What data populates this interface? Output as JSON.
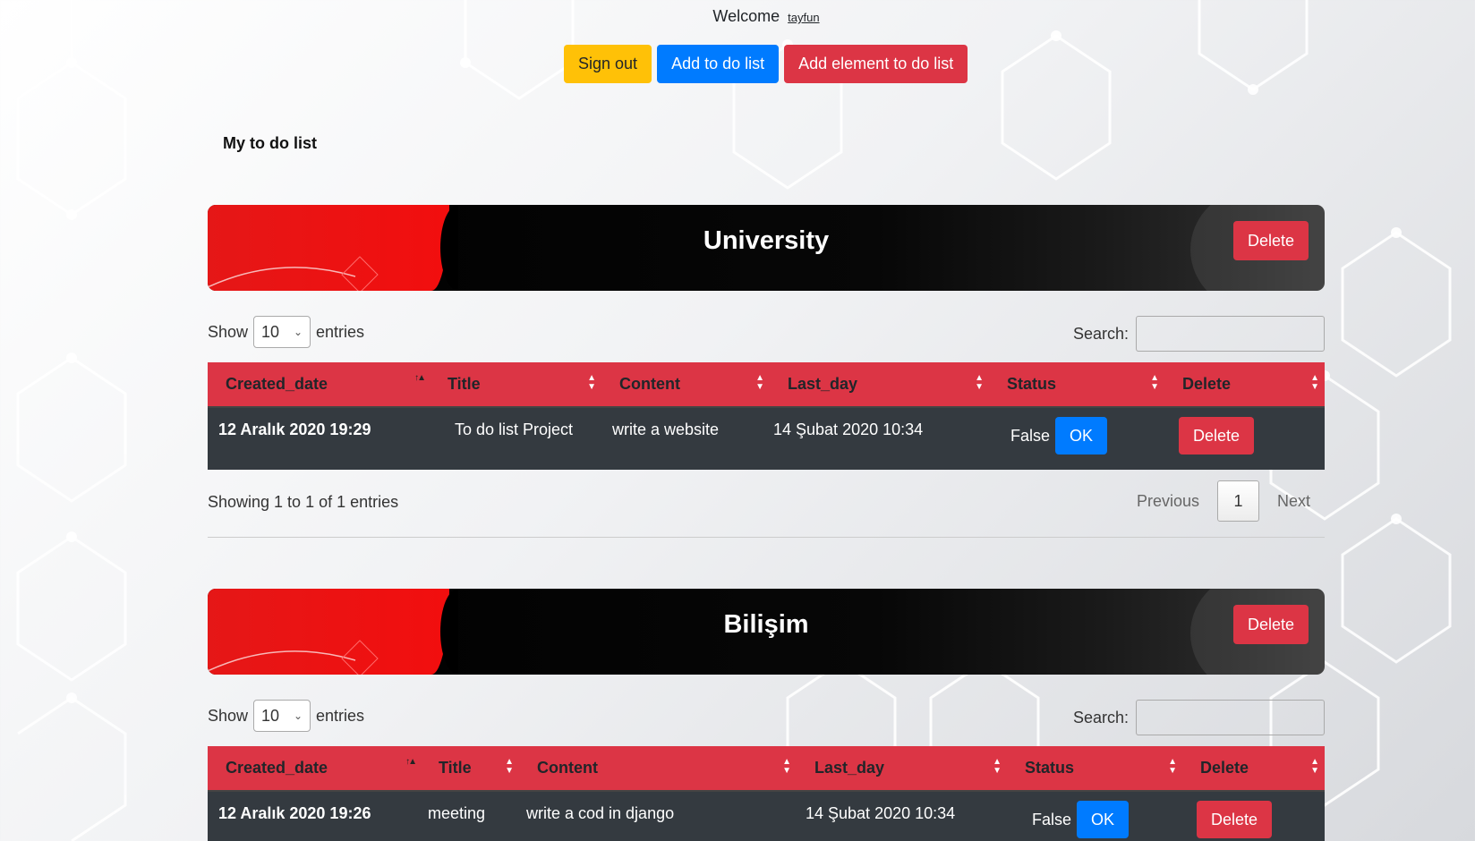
{
  "header": {
    "welcome_text": "Welcome",
    "username": "tayfun",
    "sign_out_label": "Sign out",
    "add_todo_label": "Add to do list",
    "add_element_label": "Add element to do list"
  },
  "page_heading": "My to do list",
  "colors": {
    "warning": "#ffc107",
    "primary": "#007bff",
    "danger": "#dc3545",
    "row_dark": "#343a40"
  },
  "table_labels": {
    "show": "Show",
    "entries": "entries",
    "search": "Search:",
    "page_size": "10",
    "previous": "Previous",
    "next": "Next",
    "delete_label": "Delete",
    "ok_label": "OK"
  },
  "columns": [
    "Created_date",
    "Title",
    "Content",
    "Last_day",
    "Status",
    "Delete"
  ],
  "lists": [
    {
      "name": "University",
      "rows": [
        {
          "created": "12 Aralık 2020 19:29",
          "title": "To do list Project",
          "content": "write a website",
          "last_day": "14 Şubat 2020 10:34",
          "status": "False"
        }
      ],
      "showing": "Showing 1 to 1 of 1 entries",
      "current_page": "1"
    },
    {
      "name": "Bilişim",
      "rows": [
        {
          "created": "12 Aralık 2020 19:26",
          "title": "meeting",
          "content": "write a cod in django",
          "last_day": "14 Şubat 2020 10:34",
          "status": "False"
        }
      ]
    }
  ]
}
